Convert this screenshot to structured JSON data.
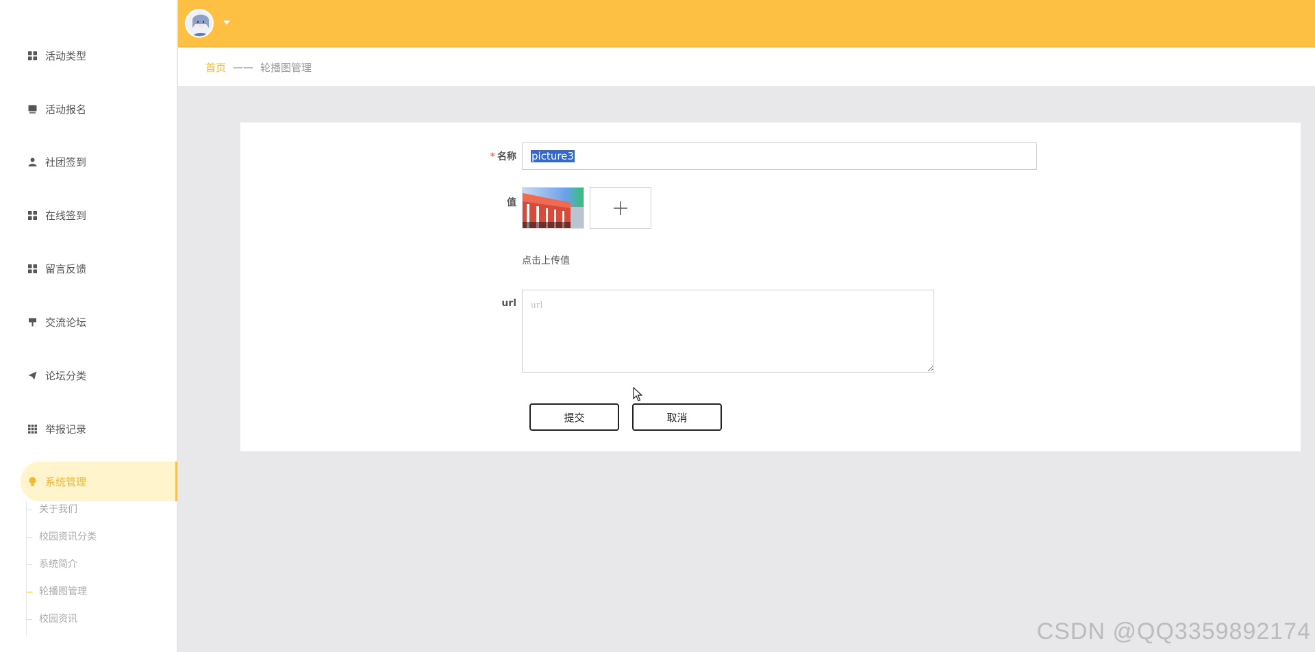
{
  "sidebar": {
    "items": [
      {
        "label": "活动类型",
        "icon": "grid-icon"
      },
      {
        "label": "活动报名",
        "icon": "square-icon"
      },
      {
        "label": "社团签到",
        "icon": "user-icon"
      },
      {
        "label": "在线签到",
        "icon": "grid-icon"
      },
      {
        "label": "留言反馈",
        "icon": "grid-icon"
      },
      {
        "label": "交流论坛",
        "icon": "flag-icon"
      },
      {
        "label": "论坛分类",
        "icon": "paper-plane-icon"
      },
      {
        "label": "举报记录",
        "icon": "apps-icon"
      },
      {
        "label": "系统管理",
        "icon": "lightbulb-icon"
      }
    ],
    "submenu": [
      "关于我们",
      "校园资讯分类",
      "系统简介",
      "轮播图管理",
      "校园资讯"
    ],
    "active_submenu_index": 3
  },
  "breadcrumb": {
    "home": "首页",
    "separator": "——",
    "current": "轮播图管理"
  },
  "form": {
    "name_label": "名称",
    "name_required_mark": "*",
    "name_value": "picture3",
    "value_label": "值",
    "upload_hint": "点击上传值",
    "url_label": "url",
    "url_placeholder": "url",
    "submit_label": "提交",
    "cancel_label": "取消"
  },
  "watermark": "CSDN @QQ3359892174",
  "colors": {
    "header": "#fec043",
    "accent": "#f5b82e",
    "active_bg": "#fff4cc"
  }
}
